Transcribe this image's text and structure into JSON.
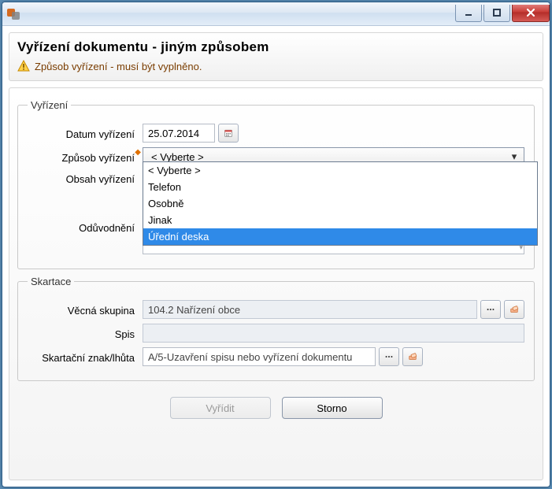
{
  "header": {
    "title": "Vyřízení dokumentu - jiným způsobem",
    "warning": "Způsob vyřízení - musí být vyplněno."
  },
  "vyrizeni": {
    "legend": "Vyřízení",
    "datum_label": "Datum vyřízení",
    "datum_value": "25.07.2014",
    "zpusob_label": "Způsob vyřízení",
    "zpusob_selected": "< Vyberte >",
    "zpusob_options": [
      "< Vyberte >",
      "Telefon",
      "Osobně",
      "Jinak",
      "Úřední deska"
    ],
    "zpusob_highlighted": "Úřední deska",
    "obsah_label": "Obsah vyřízení",
    "obsah_value": "",
    "oduv_label": "Odůvodnění",
    "oduv_value": ""
  },
  "skartace": {
    "legend": "Skartace",
    "vecna_label": "Věcná skupina",
    "vecna_value": "104.2 Nařízení obce",
    "spis_label": "Spis",
    "spis_value": "",
    "znak_label": "Skartační znak/lhůta",
    "znak_value": "A/5-Uzavření spisu nebo vyřízení dokumentu"
  },
  "footer": {
    "ok": "Vyřídit",
    "cancel": "Storno"
  }
}
